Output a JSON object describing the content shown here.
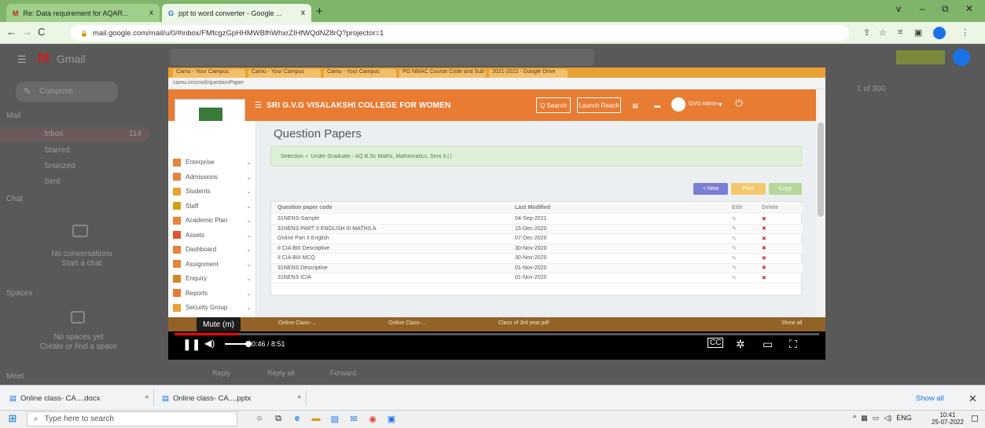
{
  "browser": {
    "tabs": [
      {
        "title": "Re: Data requirement for AQAR...",
        "close": "x",
        "favicon": "M"
      },
      {
        "title": "ppt to word converter - Google ...",
        "close": "x",
        "favicon": "G"
      }
    ],
    "new_tab": "+",
    "url": "mail.google.com/mail/u/0/#inbox/FMfcgzGpHHMWBfhWhxrZIHfWQdNZ8rQ?projector=1",
    "window_controls": [
      "v",
      "–",
      "⧉",
      "✕"
    ]
  },
  "gmail": {
    "app_name": "Gmail",
    "compose": "Compose",
    "sections": [
      "Mail",
      "Chat",
      "Spaces",
      "Meet"
    ],
    "nav": [
      "Inbox",
      "Starred",
      "Snoozed",
      "Sent"
    ],
    "inbox_count": "114",
    "chat_empty": "No conversations\nStart a chat",
    "spaces_empty": "No spaces yet\nCreate or find a space",
    "pager": "1 of 300",
    "actions": [
      "Reply",
      "Reply all",
      "Forward"
    ]
  },
  "video": {
    "inner_tabs": [
      "Camu - Your Campus",
      "Camu - Your Campus",
      "Camu - Your Campus",
      "PG NMAC Course Code and Sub",
      "2021-2022 - Google Drive"
    ],
    "inner_url": "camu.in/cms#/questionPaper",
    "college": "SRI G.V.G VISALAKSHI COLLEGE FOR WOMEN",
    "header_search": "Q Search",
    "launch_btn": "Launch Reach",
    "user": "GVG Admin",
    "sidebar": [
      {
        "label": "Enterprise",
        "color": "#e8833a"
      },
      {
        "label": "Admissions",
        "color": "#e8833a"
      },
      {
        "label": "Students",
        "color": "#e8a233"
      },
      {
        "label": "Staff",
        "color": "#d4a010"
      },
      {
        "label": "Academic Plan",
        "color": "#e8833a"
      },
      {
        "label": "Assets",
        "color": "#e0552a"
      },
      {
        "label": "Dashboard",
        "color": "#e8833a"
      },
      {
        "label": "Assignment",
        "color": "#e8833a"
      },
      {
        "label": "Enquiry",
        "color": "#d08a20"
      },
      {
        "label": "Reports",
        "color": "#e87c33"
      },
      {
        "label": "Security Group",
        "color": "#e8a233"
      }
    ],
    "page_title": "Question Papers",
    "filter_text": "Selection ✓ Under Graduate - AQ B.Sc Maths, Mathematics, Sem 3 | |",
    "buttons": [
      "+ New",
      "Print",
      "Copy"
    ],
    "table_headers": [
      "Question paper code",
      "Last Modified",
      "Edit",
      "Delete"
    ],
    "rows": [
      {
        "code": "31NENS-Sample",
        "modified": "04-Sep-2021"
      },
      {
        "code": "31NENS PART II ENGLISH III MATHS A",
        "modified": "15-Dec-2020"
      },
      {
        "code": "Online Part II English",
        "modified": "07-Dec-2020"
      },
      {
        "code": "II CIA BIII Descriptive",
        "modified": "30-Nov-2020"
      },
      {
        "code": "II CIA BIII MCQ",
        "modified": "30-Nov-2020"
      },
      {
        "code": "31NENS Descriptive",
        "modified": "01-Nov-2020"
      },
      {
        "code": "31NENS ICIA",
        "modified": "01-Nov-2020"
      }
    ],
    "subbar": [
      "Online Class-...",
      "Online Class-...",
      "Class of 3rd year.pdf",
      "Show all"
    ],
    "mute_tooltip": "Mute (m)",
    "time": "0:46 / 8:51",
    "progress": 0.1
  },
  "downloads": {
    "items": [
      "Online class- CA....docx",
      "Online class- CA....pptx"
    ],
    "show_all": "Show all",
    "close": "✕"
  },
  "taskbar": {
    "search": "Type here to search",
    "lang": "ENG",
    "time": "10:41",
    "date": "25-07-2022"
  }
}
